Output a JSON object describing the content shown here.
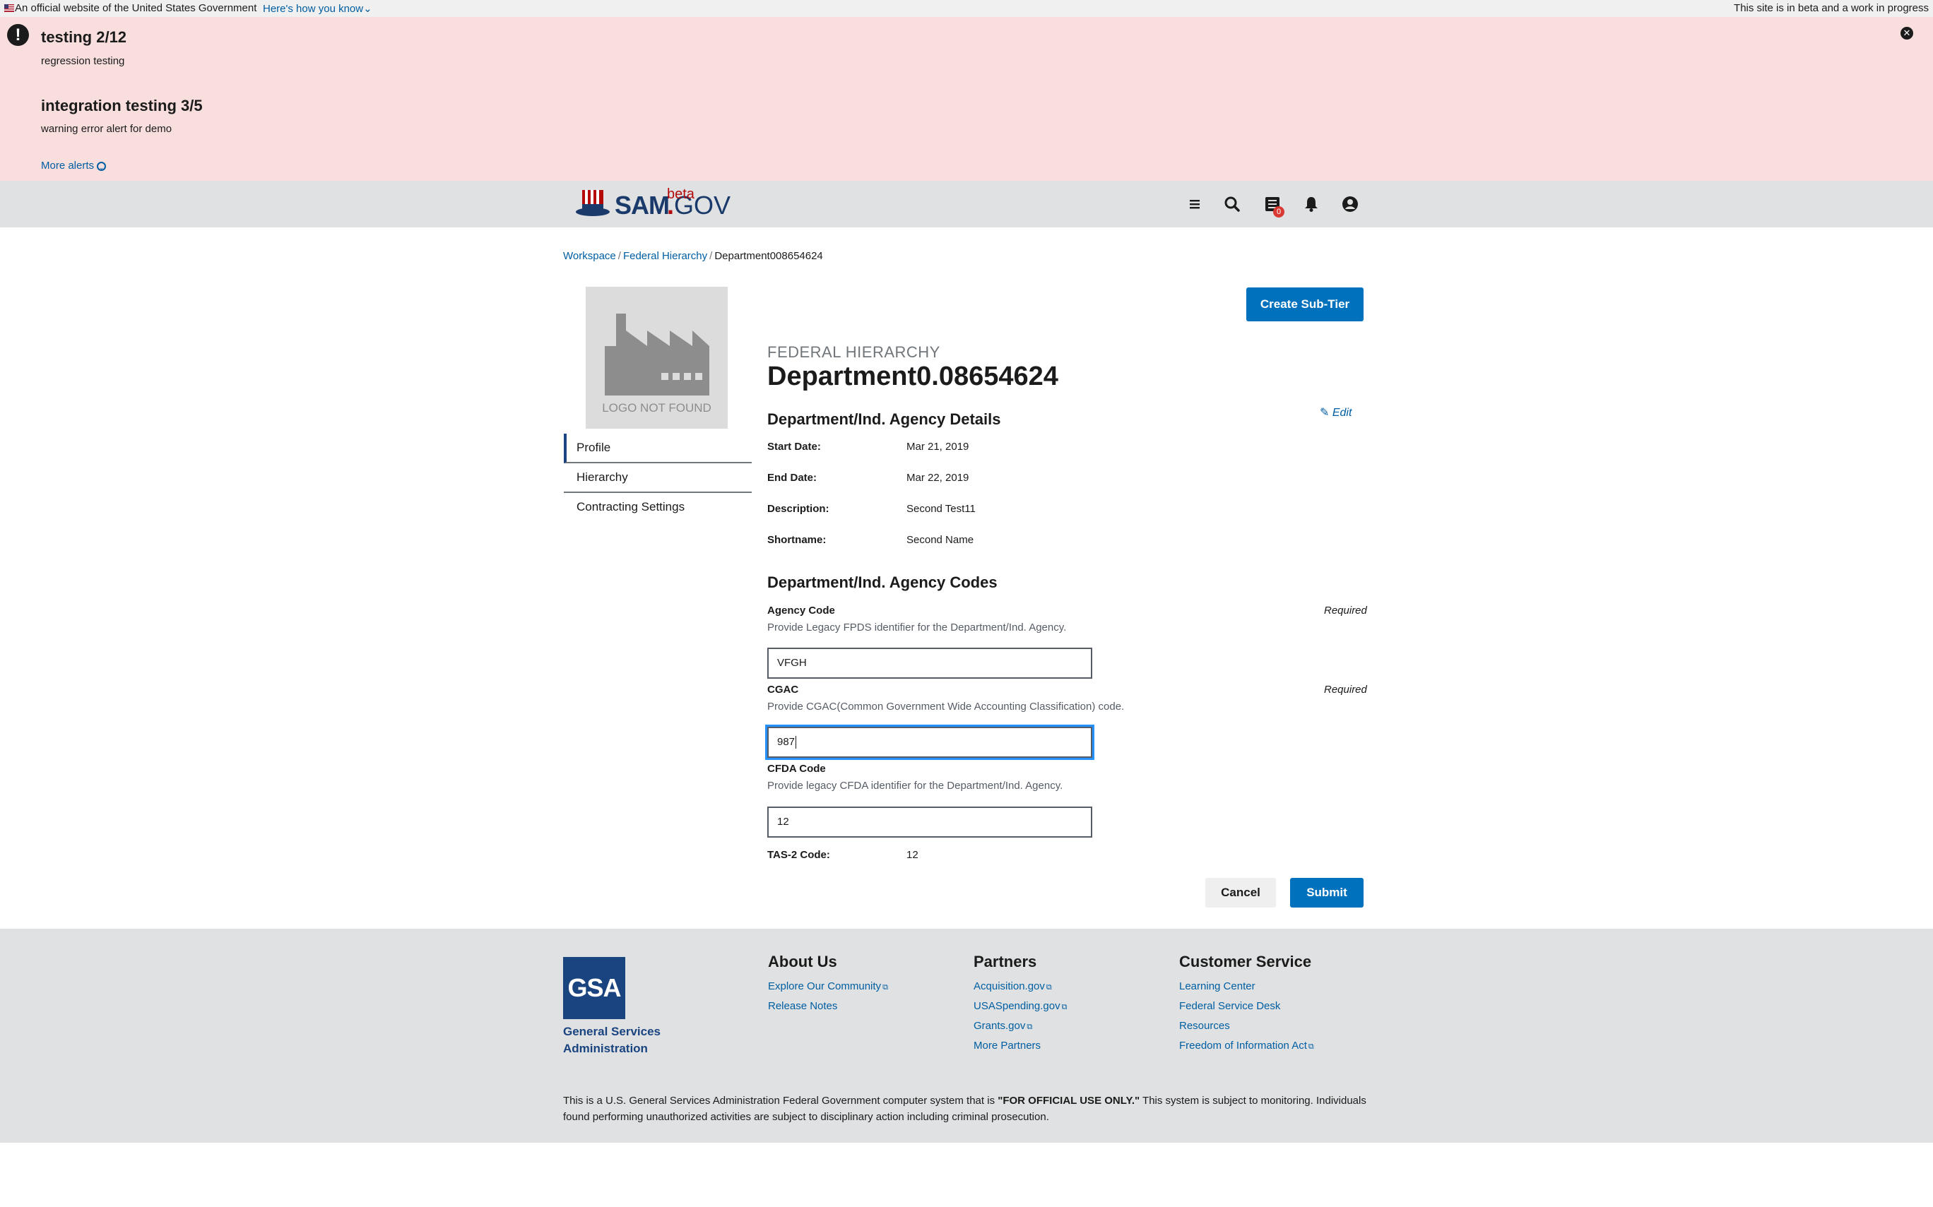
{
  "gov_banner": {
    "official_text": "An official website of the United States Government",
    "how_you_know": "Here's how you know",
    "beta_notice": "This site is in beta and a work in progress"
  },
  "alerts": {
    "items": [
      {
        "title": "testing 2/12",
        "body": "regression testing"
      },
      {
        "title": "integration testing 3/5",
        "body": "warning error alert for demo"
      }
    ],
    "more_label": "More alerts"
  },
  "header": {
    "logo_sam": "SAM",
    "logo_dot": ".",
    "logo_gov": "GOV",
    "logo_beta": "beta",
    "message_count": "0"
  },
  "breadcrumb": {
    "items": [
      "Workspace",
      "Federal Hierarchy"
    ],
    "current": "Department008654624"
  },
  "logo_placeholder": "LOGO NOT FOUND",
  "sidenav": {
    "items": [
      "Profile",
      "Hierarchy",
      "Contracting Settings"
    ]
  },
  "actions": {
    "create_subtier": "Create Sub-Tier",
    "edit": "Edit",
    "cancel": "Cancel",
    "submit": "Submit"
  },
  "page": {
    "overline": "FEDERAL HIERARCHY",
    "title": "Department0.08654624"
  },
  "details": {
    "heading": "Department/Ind. Agency Details",
    "rows": [
      {
        "label": "Start Date:",
        "value": "Mar 21, 2019"
      },
      {
        "label": "End Date:",
        "value": "Mar 22, 2019"
      },
      {
        "label": "Description:",
        "value": "Second Test11"
      },
      {
        "label": "Shortname:",
        "value": "Second Name"
      }
    ]
  },
  "codes": {
    "heading": "Department/Ind. Agency Codes",
    "agency_code": {
      "label": "Agency Code",
      "hint": "Provide Legacy FPDS identifier for the Department/Ind. Agency.",
      "required": "Required",
      "value": "VFGH"
    },
    "cgac": {
      "label": "CGAC",
      "hint": "Provide CGAC(Common Government Wide Accounting Classification) code.",
      "required": "Required",
      "value": "987"
    },
    "cfda": {
      "label": "CFDA Code",
      "hint": "Provide legacy CFDA identifier for the Department/Ind. Agency.",
      "value": "12"
    },
    "tas2": {
      "label": "TAS-2 Code:",
      "value": "12"
    }
  },
  "footer": {
    "gsa_logo": "GSA",
    "gsa_name_1": "General Services",
    "gsa_name_2": "Administration",
    "about": {
      "heading": "About Us",
      "links": [
        "Explore Our Community",
        "Release Notes"
      ]
    },
    "partners": {
      "heading": "Partners",
      "links": [
        "Acquisition.gov",
        "USASpending.gov",
        "Grants.gov",
        "More Partners"
      ]
    },
    "customer_service": {
      "heading": "Customer Service",
      "links": [
        "Learning Center",
        "Federal Service Desk",
        "Resources",
        "Freedom of Information Act"
      ]
    },
    "disclaimer_pre": "This is a U.S. General Services Administration Federal Government computer system that is ",
    "disclaimer_bold": "\"FOR OFFICIAL USE ONLY.\"",
    "disclaimer_post": " This system is subject to monitoring. Individuals found performing unauthorized activities are subject to disciplinary action including criminal prosecution."
  },
  "colors": {
    "primary": "#0071bc",
    "alert_bg": "#f9dede",
    "header_bg": "#dfe1e2",
    "brand_navy": "#1a3a6b",
    "brand_red": "#b50909"
  }
}
